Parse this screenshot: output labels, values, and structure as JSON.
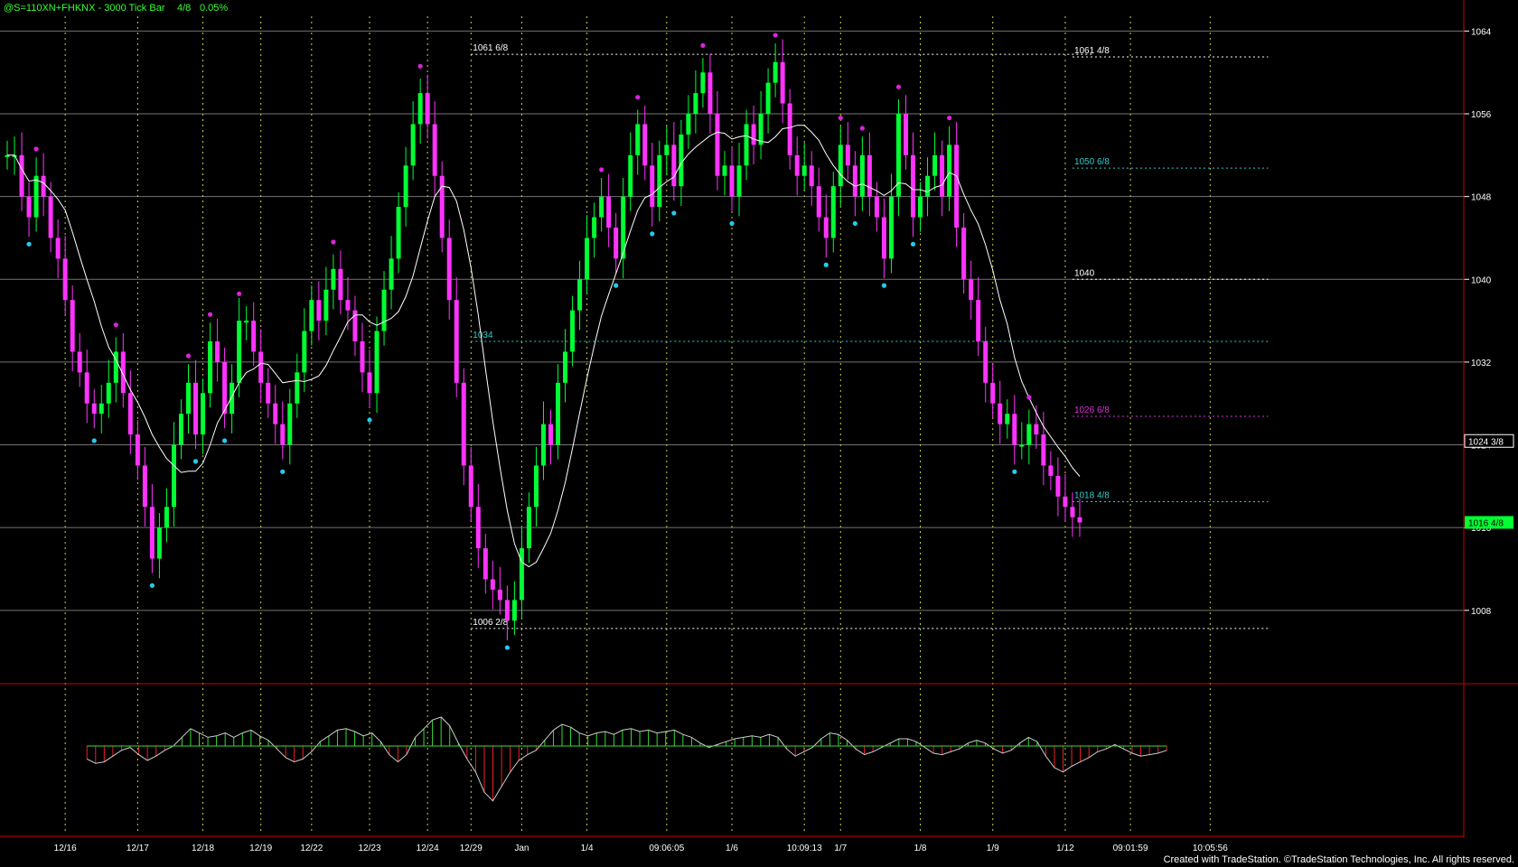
{
  "header": {
    "symbol": "@S=110XN+FHKNX - 3000 Tick Bar",
    "last_frac": "4/8",
    "change_pct": "0.05%"
  },
  "footer": {
    "credit": "Created with TradeStation. ©TradeStation Technologies, Inc. All rights reserved."
  },
  "colors": {
    "background": "#000000",
    "up_bar": "#00ff33",
    "down_bar": "#ff33ff",
    "avg_line": "#ffffff",
    "swing_high_dot": "#dd22dd",
    "swing_low_dot": "#22ccee",
    "grid": "#ffffff",
    "session_line": "#cccc44",
    "hist_pos": "#33dd33",
    "hist_neg": "#ee2222",
    "border": "#cc0000"
  },
  "chart_data": {
    "type": "candlestick",
    "price_axis": {
      "range": [
        1001,
        1067
      ],
      "ticks": [
        1008,
        1016,
        1024,
        1032,
        1040,
        1048,
        1056,
        1064
      ],
      "current_price_label": "1016 4/8",
      "current_price": 1016.5,
      "marker_label": "1024 3/8",
      "marker_price": 1024.375
    },
    "x_axis": {
      "labels": [
        {
          "text": "12/16",
          "i": 8
        },
        {
          "text": "12/17",
          "i": 18
        },
        {
          "text": "12/18",
          "i": 27
        },
        {
          "text": "12/19",
          "i": 35
        },
        {
          "text": "12/22",
          "i": 42
        },
        {
          "text": "12/23",
          "i": 50
        },
        {
          "text": "12/24",
          "i": 58
        },
        {
          "text": "12/29",
          "i": 64
        },
        {
          "text": "Jan",
          "i": 71
        },
        {
          "text": "1/4",
          "i": 80
        },
        {
          "text": "09:06:05",
          "i": 91
        },
        {
          "text": "1/6",
          "i": 100
        },
        {
          "text": "10:09:13",
          "i": 110
        },
        {
          "text": "1/7",
          "i": 115
        },
        {
          "text": "1/8",
          "i": 126
        },
        {
          "text": "1/9",
          "i": 136
        },
        {
          "text": "1/12",
          "i": 146
        },
        {
          "text": "09:01:59",
          "i": 155
        },
        {
          "text": "10:05:56",
          "i": 166
        }
      ]
    },
    "candles_close": [
      1052,
      1052,
      1048,
      1046,
      1050,
      1048,
      1044,
      1042,
      1038,
      1033,
      1031,
      1028,
      1027,
      1028,
      1030,
      1033,
      1029,
      1025,
      1022,
      1018,
      1013,
      1016,
      1018,
      1024,
      1027,
      1030,
      1025,
      1029,
      1034,
      1032,
      1027,
      1030,
      1036,
      1036,
      1033,
      1030,
      1028,
      1026,
      1024,
      1028,
      1031,
      1035,
      1038,
      1036,
      1039,
      1041,
      1038,
      1037,
      1034,
      1031,
      1029,
      1035,
      1039,
      1042,
      1047,
      1051,
      1055,
      1058,
      1055,
      1050,
      1044,
      1038,
      1030,
      1022,
      1018,
      1014,
      1011,
      1010,
      1009,
      1007,
      1009,
      1014,
      1018,
      1022,
      1026,
      1024,
      1030,
      1033,
      1037,
      1040,
      1044,
      1046,
      1048,
      1045,
      1042,
      1048,
      1052,
      1055,
      1051,
      1047,
      1052,
      1053,
      1049,
      1054,
      1056,
      1058,
      1060,
      1056,
      1050,
      1051,
      1048,
      1051,
      1055,
      1053,
      1056,
      1059,
      1061,
      1057,
      1052,
      1050,
      1051,
      1049,
      1046,
      1044,
      1049,
      1053,
      1051,
      1048,
      1052,
      1048,
      1046,
      1042,
      1048,
      1056,
      1052,
      1046,
      1048,
      1050,
      1052,
      1048,
      1053,
      1045,
      1040,
      1038,
      1034,
      1030,
      1028,
      1026,
      1027,
      1024,
      1024,
      1026,
      1025,
      1022,
      1021,
      1019,
      1018,
      1017,
      1016.5
    ],
    "hist_values": [
      -0.45,
      -0.6,
      -0.55,
      -0.35,
      -0.15,
      -0.05,
      -0.3,
      -0.5,
      -0.35,
      -0.15,
      0,
      0.3,
      0.6,
      0.45,
      0.3,
      0.35,
      0.45,
      0.3,
      0.45,
      0.55,
      0.35,
      0.2,
      -0.1,
      -0.4,
      -0.55,
      -0.45,
      -0.2,
      0.15,
      0.35,
      0.55,
      0.6,
      0.5,
      0.35,
      0.45,
      0.15,
      -0.3,
      -0.55,
      -0.3,
      0.3,
      0.6,
      0.9,
      1.0,
      0.7,
      0.1,
      -0.45,
      -0.9,
      -1.6,
      -1.9,
      -1.4,
      -0.9,
      -0.5,
      -0.3,
      -0.15,
      0.2,
      0.55,
      0.75,
      0.65,
      0.45,
      0.35,
      0.45,
      0.5,
      0.4,
      0.55,
      0.6,
      0.5,
      0.55,
      0.45,
      0.5,
      0.55,
      0.4,
      0.3,
      0.1,
      -0.05,
      0.05,
      0.15,
      0.25,
      0.3,
      0.35,
      0.3,
      0.4,
      0.3,
      -0.1,
      -0.35,
      -0.2,
      -0.05,
      0.25,
      0.45,
      0.4,
      0.2,
      -0.1,
      -0.3,
      -0.2,
      -0.05,
      0.1,
      0.25,
      0.25,
      0.15,
      -0.05,
      -0.25,
      -0.3,
      -0.2,
      -0.1,
      0.1,
      0.2,
      0.1,
      -0.1,
      -0.25,
      -0.15,
      0.1,
      0.3,
      0.15,
      -0.35,
      -0.75,
      -0.9,
      -0.7,
      -0.55,
      -0.4,
      -0.2,
      -0.1,
      0.05,
      -0.1,
      -0.25,
      -0.35,
      -0.3,
      -0.25,
      -0.15
    ],
    "annotations": [
      {
        "text": "1061 6/8",
        "i": 64,
        "price": 1061.75,
        "color": "#ffffff",
        "line": "dotted",
        "to_i": 150
      },
      {
        "text": "1061 4/8",
        "i": 147,
        "price": 1061.5,
        "color": "#ffffff",
        "line": "dotted",
        "to_i": 174
      },
      {
        "text": "1050 6/8",
        "i": 147,
        "price": 1050.75,
        "color": "#33cccc",
        "line": "dotted",
        "to_i": 174
      },
      {
        "text": "1040",
        "i": 147,
        "price": 1040,
        "color": "#ffffff",
        "line": "dotted",
        "to_i": 174
      },
      {
        "text": "1034",
        "i": 64,
        "price": 1034,
        "color": "#33cccc",
        "line": "dotted",
        "to_i": 174
      },
      {
        "text": "1026 6/8",
        "i": 147,
        "price": 1026.75,
        "color": "#dd33dd",
        "line": "dotted",
        "to_i": 174
      },
      {
        "text": "1018 4/8",
        "i": 147,
        "price": 1018.5,
        "color": "#33cccc",
        "line": "dotted",
        "to_i": 174
      },
      {
        "text": "1006 2/8",
        "i": 64,
        "price": 1006.25,
        "color": "#ffffff",
        "line": "dotted",
        "to_i": 174
      }
    ]
  }
}
